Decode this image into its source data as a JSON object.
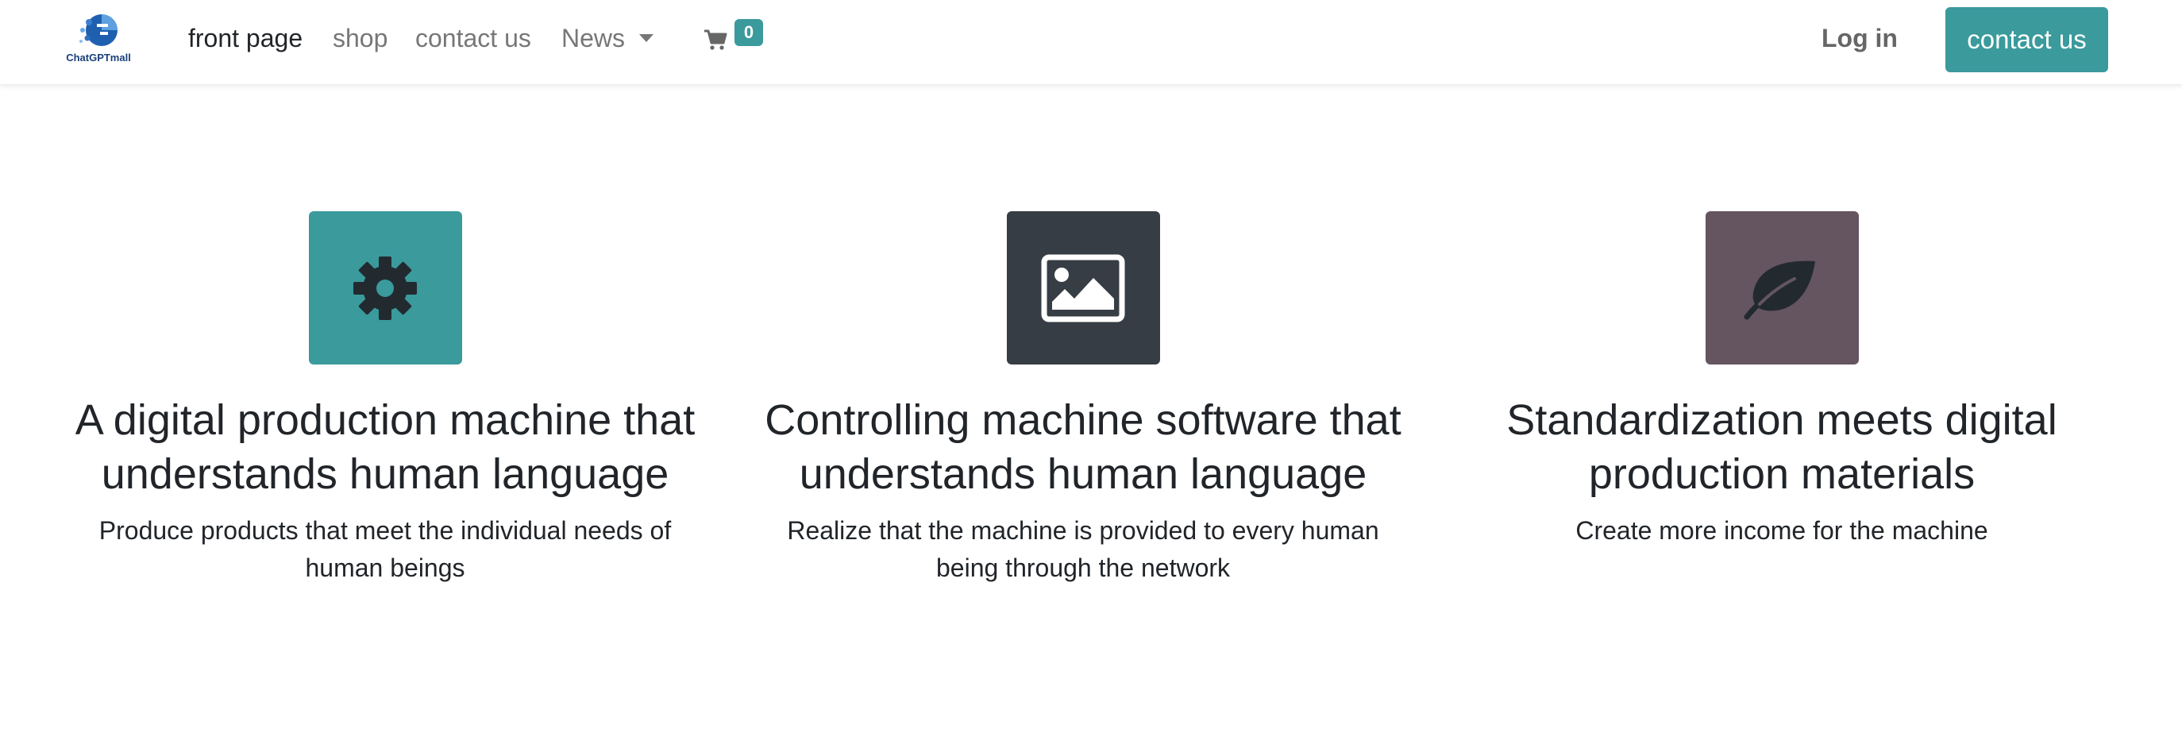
{
  "nav": {
    "brand": "ChatGPTmall",
    "links": [
      "front page",
      "shop",
      "contact us",
      "News"
    ],
    "cart_count": "0",
    "login": "Log in",
    "cta": "contact us"
  },
  "features": [
    {
      "icon": "gear-icon",
      "color": "#3a9a9c",
      "title": "A digital production machine that understands human language",
      "text": "Produce products that meet the individual needs of human beings"
    },
    {
      "icon": "image-icon",
      "color": "#373d44",
      "title": "Controlling machine software that understands human language",
      "text": "Realize that the machine is provided to every human being through the network"
    },
    {
      "icon": "leaf-icon",
      "color": "#645561",
      "title": "Standardization meets digital production materials",
      "text": "Create more income for the machine"
    }
  ],
  "colors": {
    "accent": "#3a9a9c",
    "text": "#212529",
    "nav_muted": "#777777"
  }
}
